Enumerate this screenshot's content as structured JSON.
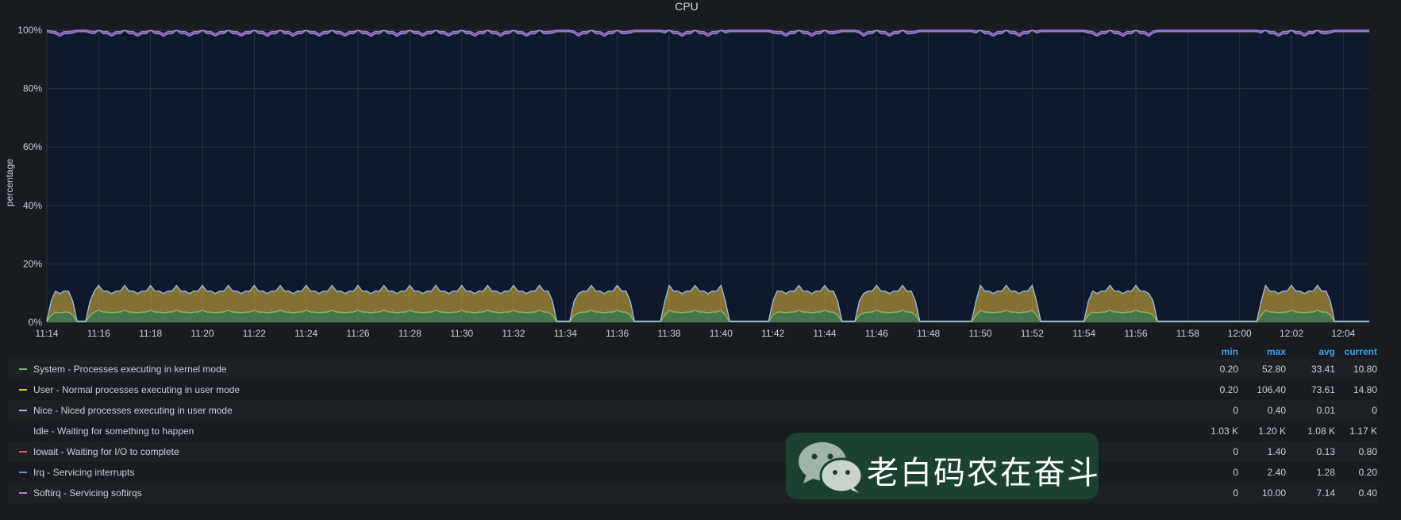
{
  "panel": {
    "title": "CPU"
  },
  "chart_data": {
    "type": "area",
    "title": "CPU",
    "xlabel": "",
    "ylabel": "percentage",
    "ylim": [
      0,
      100
    ],
    "y_ticks": [
      "0%",
      "20%",
      "40%",
      "60%",
      "80%",
      "100%"
    ],
    "x_ticks": [
      "11:14",
      "11:16",
      "11:18",
      "11:20",
      "11:22",
      "11:24",
      "11:26",
      "11:28",
      "11:30",
      "11:32",
      "11:34",
      "11:36",
      "11:38",
      "11:40",
      "11:42",
      "11:44",
      "11:46",
      "11:48",
      "11:50",
      "11:52",
      "11:54",
      "11:56",
      "11:58",
      "12:00",
      "12:02",
      "12:04"
    ],
    "x_range": [
      "11:14",
      "12:05"
    ],
    "grid": true,
    "stacked": true,
    "legend_position": "bottom",
    "active_windows": [
      [
        "11:14",
        "11:15:10"
      ],
      [
        "11:15:30",
        "11:33:40"
      ],
      [
        "11:34:10",
        "11:36:40"
      ],
      [
        "11:37:40",
        "11:40:20"
      ],
      [
        "11:41:50",
        "11:44:40"
      ],
      [
        "11:45:10",
        "11:47:40"
      ],
      [
        "11:49:40",
        "11:52:20"
      ],
      [
        "11:54:00",
        "11:56:50"
      ],
      [
        "12:00:40",
        "12:03:40"
      ]
    ],
    "series": [
      {
        "name": "System - Processes executing in kernel mode",
        "color": "#73bf69",
        "active_pct": 3.5,
        "idle_pct": 0.2
      },
      {
        "name": "User - Normal processes executing in user mode",
        "color": "#e8b93c",
        "active_pct": 7.2,
        "idle_pct": 0.2
      },
      {
        "name": "Nice - Niced processes executing in user mode",
        "color": "#8ab8ff",
        "active_pct": 0.0,
        "idle_pct": 0.0
      },
      {
        "name": "Idle - Waiting for something to happen",
        "color": "#0e2338",
        "active_pct": 88.0,
        "idle_pct": 99.0
      },
      {
        "name": "Iowait - Waiting for I/O to complete",
        "color": "#f2495c",
        "active_pct": 0.1,
        "idle_pct": 0.1
      },
      {
        "name": "Irq - Servicing interrupts",
        "color": "#5794f2",
        "active_pct": 0.1,
        "idle_pct": 0.1
      },
      {
        "name": "Softirq - Servicing softirqs",
        "color": "#b877d9",
        "active_pct": 0.7,
        "idle_pct": 0.4
      }
    ]
  },
  "legend": {
    "columns": [
      "min",
      "max",
      "avg",
      "current"
    ],
    "rows": [
      {
        "name": "System - Processes executing in kernel mode",
        "color": "#73bf69",
        "min": "0.20",
        "max": "52.80",
        "avg": "33.41",
        "current": "10.80"
      },
      {
        "name": "User - Normal processes executing in user mode",
        "color": "#e8b93c",
        "min": "0.20",
        "max": "106.40",
        "avg": "73.61",
        "current": "14.80"
      },
      {
        "name": "Nice - Niced processes executing in user mode",
        "color": "#8ab8ff",
        "min": "0",
        "max": "0.40",
        "avg": "0.01",
        "current": "0"
      },
      {
        "name": "Idle - Waiting for something to happen",
        "color": "#0e2338",
        "min": "1.03 K",
        "max": "1.20 K",
        "avg": "1.08 K",
        "current": "1.17 K"
      },
      {
        "name": "Iowait - Waiting for I/O to complete",
        "color": "#f2495c",
        "min": "0",
        "max": "1.40",
        "avg": "0.13",
        "current": "0.80"
      },
      {
        "name": "Irq - Servicing interrupts",
        "color": "#5794f2",
        "min": "0",
        "max": "2.40",
        "avg": "1.28",
        "current": "0.20"
      },
      {
        "name": "Softirq - Servicing softirqs",
        "color": "#b877d9",
        "min": "0",
        "max": "10.00",
        "avg": "7.14",
        "current": "0.40"
      }
    ]
  },
  "watermark": {
    "text": "老白码农在奋斗",
    "icon": "wechat-icon"
  }
}
